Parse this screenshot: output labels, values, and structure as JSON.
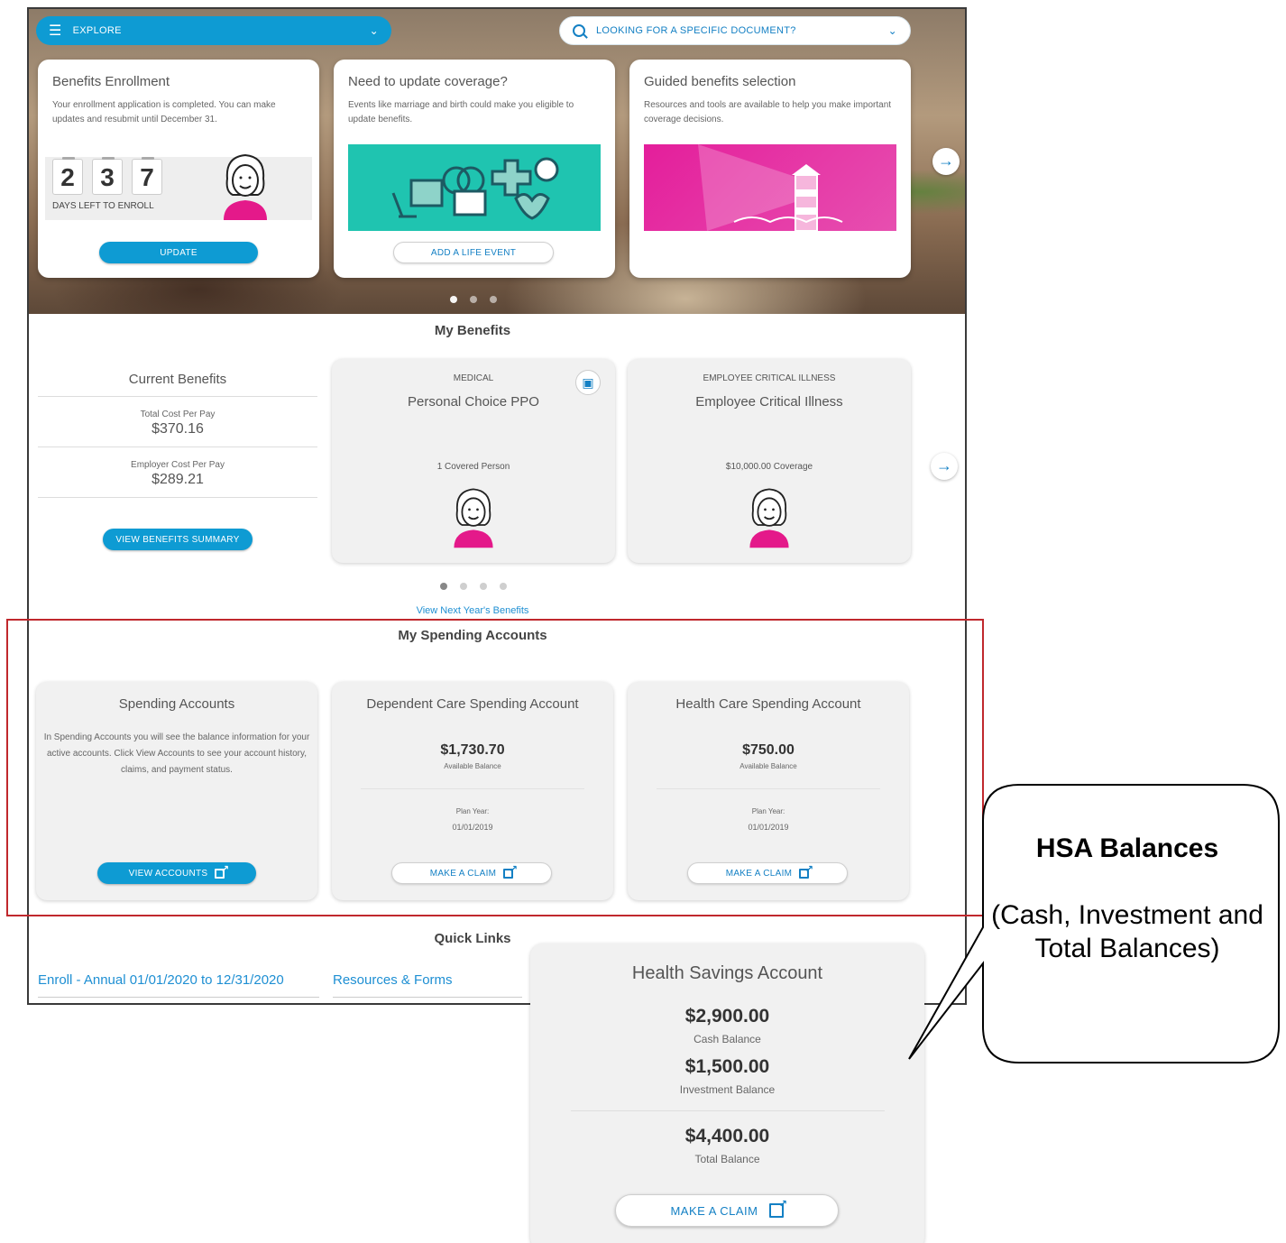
{
  "header": {
    "explore_label": "EXPLORE",
    "search_placeholder": "LOOKING FOR A SPECIFIC DOCUMENT?"
  },
  "hero_cards": [
    {
      "title": "Benefits Enrollment",
      "description": "Your enrollment application is completed. You can make updates and resubmit until December 31.",
      "countdown_digits": [
        "2",
        "3",
        "7"
      ],
      "countdown_label": "DAYS LEFT TO ENROLL",
      "button": "UPDATE"
    },
    {
      "title": "Need to update coverage?",
      "description": "Events like marriage and birth could make you eligible to update benefits.",
      "button": "ADD A LIFE EVENT"
    },
    {
      "title": "Guided benefits selection",
      "description": "Resources and tools are available to help you make important coverage decisions."
    }
  ],
  "my_benefits": {
    "section_title": "My Benefits",
    "current": {
      "title": "Current Benefits",
      "total_cost_label": "Total Cost Per Pay",
      "total_cost_value": "$370.16",
      "employer_cost_label": "Employer Cost Per Pay",
      "employer_cost_value": "$289.21",
      "button": "VIEW BENEFITS SUMMARY"
    },
    "cards": [
      {
        "category": "MEDICAL",
        "name": "Personal Choice PPO",
        "detail": "1 Covered Person"
      },
      {
        "category": "EMPLOYEE CRITICAL ILLNESS",
        "name": "Employee Critical Illness",
        "detail": "$10,000.00 Coverage"
      }
    ],
    "next_year_link": "View Next Year's Benefits"
  },
  "spending": {
    "section_title": "My Spending Accounts",
    "summary": {
      "title": "Spending Accounts",
      "description": "In Spending Accounts you will see the balance information for your active accounts. Click View Accounts to see your account history, claims, and payment status.",
      "button": "VIEW ACCOUNTS"
    },
    "accounts": [
      {
        "title": "Dependent Care Spending Account",
        "amount": "$1,730.70",
        "amount_label": "Available Balance",
        "plan_year_label": "Plan Year:",
        "plan_year": "01/01/2019",
        "button": "MAKE A CLAIM"
      },
      {
        "title": "Health Care Spending Account",
        "amount": "$750.00",
        "amount_label": "Available Balance",
        "plan_year_label": "Plan Year:",
        "plan_year": "01/01/2019",
        "button": "MAKE A CLAIM"
      }
    ]
  },
  "quick_links": {
    "section_title": "Quick Links",
    "links": [
      "Enroll - Annual 01/01/2020 to 12/31/2020",
      "Resources & Forms"
    ]
  },
  "hsa": {
    "title": "Health Savings Account",
    "cash": "$2,900.00",
    "cash_label": "Cash Balance",
    "investment": "$1,500.00",
    "investment_label": "Investment Balance",
    "total": "$4,400.00",
    "total_label": "Total Balance",
    "button": "MAKE A CLAIM"
  },
  "callout": {
    "heading": "HSA Balances",
    "body": "(Cash, Investment and Total Balances)"
  },
  "colors": {
    "accent": "#0e9bd3",
    "link": "#1e8fd3",
    "highlight": "#c0282d",
    "avatar_shirt": "#e4198a",
    "teal_illustration": "#1fc4b0",
    "pink_illustration": "#e41e9b"
  }
}
